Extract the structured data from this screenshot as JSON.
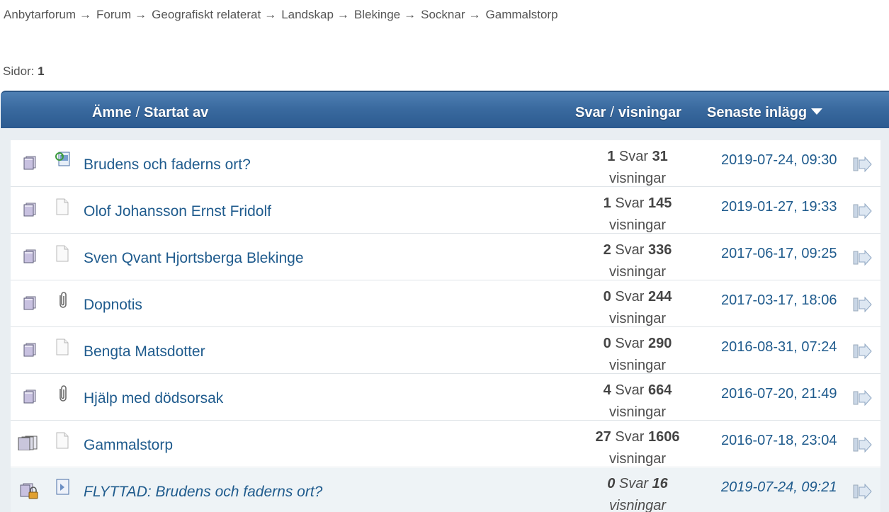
{
  "breadcrumb": {
    "items": [
      "Anbytarforum",
      "Forum",
      "Geografiskt relaterat",
      "Landskap",
      "Blekinge",
      "Socknar",
      "Gammalstorp"
    ],
    "separator": "→"
  },
  "pagination": {
    "label": "Sidor:",
    "current": "1"
  },
  "header": {
    "subject": "Ämne",
    "started_by": "Startat av",
    "replies": "Svar",
    "views": "visningar",
    "last_post": "Senaste inlägg",
    "slash": "/"
  },
  "topics": [
    {
      "subject": "Brudens och faderns ort?",
      "replies": "1",
      "replies_label": "Svar",
      "views": "31",
      "views_label": "visningar",
      "last_post": "2019-07-24, 09:30",
      "board_icon": "board-icon",
      "message_icon": "recycled-topic-icon",
      "moved": false
    },
    {
      "subject": "Olof Johansson Ernst Fridolf",
      "replies": "1",
      "replies_label": "Svar",
      "views": "145",
      "views_label": "visningar",
      "last_post": "2019-01-27, 19:33",
      "board_icon": "board-icon",
      "message_icon": "document-icon",
      "moved": false
    },
    {
      "subject": "Sven Qvant Hjortsberga Blekinge",
      "replies": "2",
      "replies_label": "Svar",
      "views": "336",
      "views_label": "visningar",
      "last_post": "2017-06-17, 09:25",
      "board_icon": "board-icon",
      "message_icon": "document-icon",
      "moved": false
    },
    {
      "subject": "Dopnotis",
      "replies": "0",
      "replies_label": "Svar",
      "views": "244",
      "views_label": "visningar",
      "last_post": "2017-03-17, 18:06",
      "board_icon": "board-icon",
      "message_icon": "paperclip-icon",
      "moved": false
    },
    {
      "subject": "Bengta Matsdotter",
      "replies": "0",
      "replies_label": "Svar",
      "views": "290",
      "views_label": "visningar",
      "last_post": "2016-08-31, 07:24",
      "board_icon": "board-icon",
      "message_icon": "document-icon",
      "moved": false
    },
    {
      "subject": "Hjälp med dödsorsak",
      "replies": "4",
      "replies_label": "Svar",
      "views": "664",
      "views_label": "visningar",
      "last_post": "2016-07-20, 21:49",
      "board_icon": "board-icon",
      "message_icon": "paperclip-icon",
      "moved": false
    },
    {
      "subject": "Gammalstorp",
      "replies": "27",
      "replies_label": "Svar",
      "views": "1606",
      "views_label": "visningar",
      "last_post": "2016-07-18, 23:04",
      "board_icon": "hot-board-icon",
      "message_icon": "document-icon",
      "moved": false
    },
    {
      "subject": "FLYTTAD: Brudens och faderns ort?",
      "replies": "0",
      "replies_label": "Svar",
      "views": "16",
      "views_label": "visningar",
      "last_post": "2019-07-24, 09:21",
      "board_icon": "locked-board-icon",
      "message_icon": "moved-topic-icon",
      "moved": true
    }
  ],
  "colors": {
    "header_top": "#4e7fb3",
    "header_bottom": "#2b5a90",
    "link": "#1f5b8d",
    "body_bg": "#e9eef2"
  }
}
